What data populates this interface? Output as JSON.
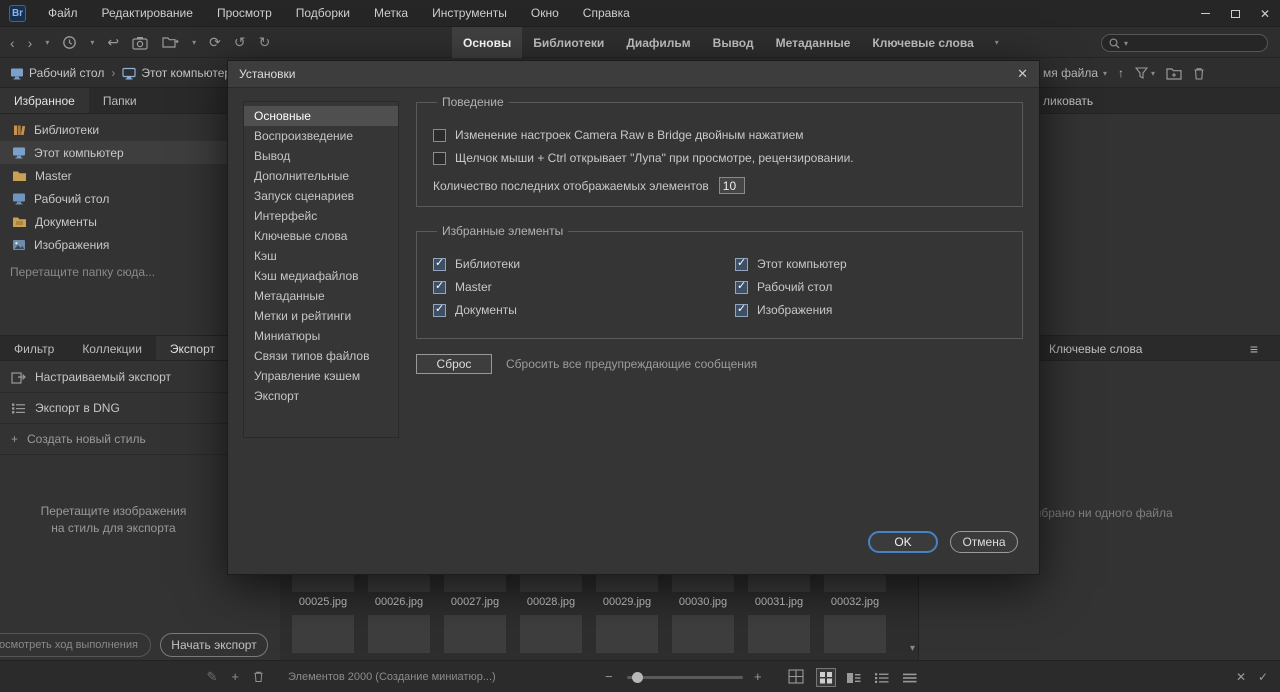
{
  "titlebar": {
    "app_logo": "Br",
    "menus": [
      "Файл",
      "Редактирование",
      "Просмотр",
      "Подборки",
      "Метка",
      "Инструменты",
      "Окно",
      "Справка"
    ]
  },
  "workspace_tabs": [
    "Основы",
    "Библиотеки",
    "Диафильм",
    "Вывод",
    "Метаданные",
    "Ключевые слова"
  ],
  "pathbar": {
    "crumbs": [
      "Рабочий стол",
      "Этот компьютер"
    ],
    "sort_field": "мя файла"
  },
  "left_panel": {
    "tabs": [
      "Избранное",
      "Папки"
    ],
    "favorites": [
      "Библиотеки",
      "Этот компьютер",
      "Master",
      "Рабочий стол",
      "Документы",
      "Изображения"
    ],
    "drop_hint": "Перетащите папку сюда...",
    "bottom_tabs": [
      "Фильтр",
      "Коллекции",
      "Экспорт"
    ],
    "export_presets": [
      "Настраиваемый экспорт",
      "Экспорт в DNG"
    ],
    "new_style": "Создать новый стиль",
    "drag_hint_line1": "Перетащите изображения",
    "drag_hint_line2": "на стиль для экспорта",
    "progress_button": "осмотреть ход выполнения",
    "start_export": "Начать экспорт"
  },
  "dialog": {
    "title": "Установки",
    "nav": [
      "Основные",
      "Воспроизведение",
      "Вывод",
      "Дополнительные",
      "Запуск сценариев",
      "Интерфейс",
      "Ключевые слова",
      "Кэш",
      "Кэш медиафайлов",
      "Метаданные",
      "Метки и рейтинги",
      "Миниатюры",
      "Связи типов файлов",
      "Управление кэшем",
      "Экспорт"
    ],
    "active_nav": "Основные",
    "behavior": {
      "legend": "Поведение",
      "options": [
        {
          "label": "Изменение настроек Camera Raw в Bridge двойным нажатием",
          "checked": false
        },
        {
          "label": "Щелчок мыши + Ctrl открывает \"Лупа\" при просмотре, рецензировании.",
          "checked": false
        }
      ],
      "recent_label": "Количество последних отображаемых элементов",
      "recent_value": "10"
    },
    "favorites": {
      "legend": "Избранные элементы",
      "left": [
        {
          "label": "Библиотеки",
          "checked": true
        },
        {
          "label": "Master",
          "checked": true
        },
        {
          "label": "Документы",
          "checked": true
        }
      ],
      "right": [
        {
          "label": "Этот компьютер",
          "checked": true
        },
        {
          "label": "Рабочий стол",
          "checked": true
        },
        {
          "label": "Изображения",
          "checked": true
        }
      ]
    },
    "reset_button": "Сброс",
    "reset_caption": "Сбросить все предупреждающие сообщения",
    "ok_button": "OK",
    "cancel_button": "Отмена"
  },
  "right_panel": {
    "publish_tab": "ликовать",
    "keywords_header": "Ключевые слова",
    "empty_message": "выбрано ни одного файла"
  },
  "thumbnails": [
    "00025.jpg",
    "00026.jpg",
    "00027.jpg",
    "00028.jpg",
    "00029.jpg",
    "00030.jpg",
    "00031.jpg",
    "00032.jpg"
  ],
  "statusbar": {
    "items_text": "Элементов 2000 (Создание миниатюр...)"
  },
  "colors": {
    "accent_blue": "#4683c6",
    "panel_bg": "#333333",
    "dialog_bg": "#353535"
  },
  "glyphs": {
    "close": "✕",
    "back": "‹",
    "forward": "›",
    "chevron_down": "▾",
    "undo": "↺",
    "redo": "↻",
    "refresh": "⟳",
    "return_arrow": "↩",
    "separator": "›",
    "up_arrow": "↑",
    "plus": "+",
    "pen": "✎",
    "hamburger": "≡",
    "check": "✓",
    "cross": "✕",
    "minus": "−"
  }
}
